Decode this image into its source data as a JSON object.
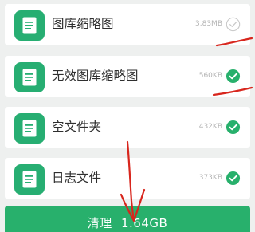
{
  "items": [
    {
      "label": "图库缩略图",
      "size": "3.83MB",
      "checked": false
    },
    {
      "label": "无效图库缩略图",
      "size": "560KB",
      "checked": true
    },
    {
      "label": "空文件夹",
      "size": "432KB",
      "checked": true
    },
    {
      "label": "日志文件",
      "size": "373KB",
      "checked": true
    }
  ],
  "clean_button": {
    "label": "清理",
    "total": "1.64GB"
  },
  "icons": {
    "item_icon": "document-icon",
    "checked_icon": "check-circle-filled-icon",
    "unchecked_icon": "check-circle-outline-icon"
  },
  "colors": {
    "accent": "#28b06c",
    "annotation": "#d8261d"
  }
}
